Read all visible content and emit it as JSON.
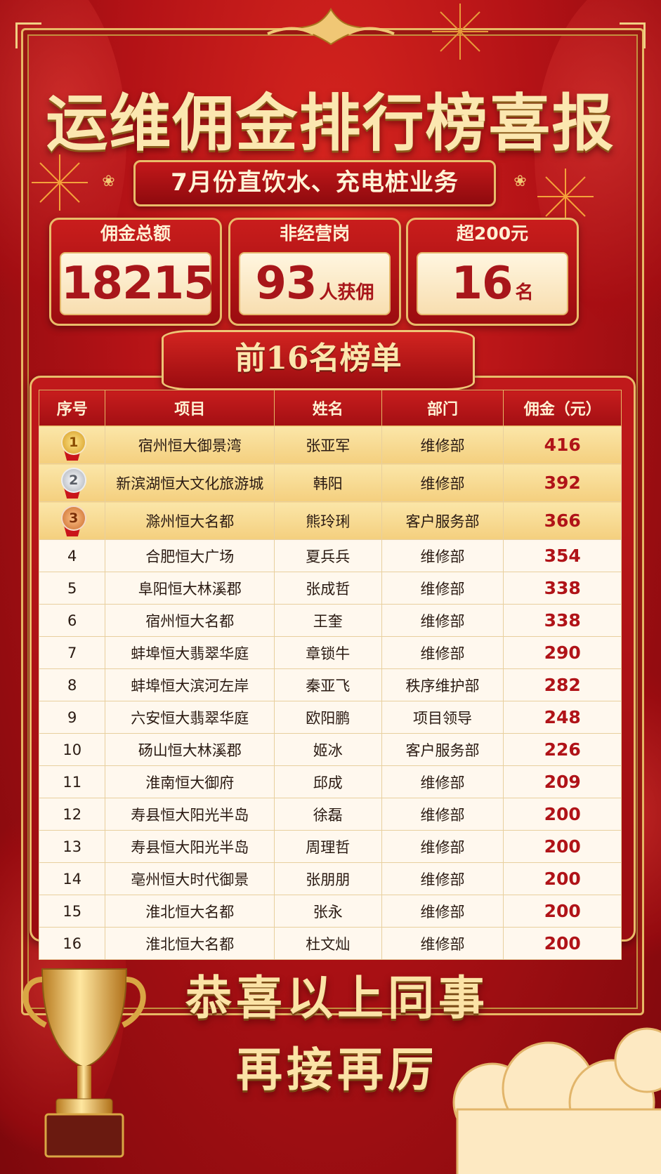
{
  "title": "运维佣金排行榜喜报",
  "subtitle": "7月份直饮水、充电桩业务",
  "stats": [
    {
      "label": "佣金总额",
      "value": "18215",
      "unit": ""
    },
    {
      "label": "非经营岗",
      "value": "93",
      "unit": "人获佣"
    },
    {
      "label": "超200元",
      "value": "16",
      "unit": "名"
    }
  ],
  "rank_title": "前16名榜单",
  "table": {
    "headers": [
      "序号",
      "项目",
      "姓名",
      "部门",
      "佣金（元）"
    ],
    "rows": [
      {
        "rank": "1",
        "project": "宿州恒大御景湾",
        "name": "张亚军",
        "dept": "维修部",
        "amount": "416"
      },
      {
        "rank": "2",
        "project": "新滨湖恒大文化旅游城",
        "name": "韩阳",
        "dept": "维修部",
        "amount": "392"
      },
      {
        "rank": "3",
        "project": "滁州恒大名都",
        "name": "熊玲琍",
        "dept": "客户服务部",
        "amount": "366"
      },
      {
        "rank": "4",
        "project": "合肥恒大广场",
        "name": "夏兵兵",
        "dept": "维修部",
        "amount": "354"
      },
      {
        "rank": "5",
        "project": "阜阳恒大林溪郡",
        "name": "张成哲",
        "dept": "维修部",
        "amount": "338"
      },
      {
        "rank": "6",
        "project": "宿州恒大名都",
        "name": "王奎",
        "dept": "维修部",
        "amount": "338"
      },
      {
        "rank": "7",
        "project": "蚌埠恒大翡翠华庭",
        "name": "章锁牛",
        "dept": "维修部",
        "amount": "290"
      },
      {
        "rank": "8",
        "project": "蚌埠恒大滨河左岸",
        "name": "秦亚飞",
        "dept": "秩序维护部",
        "amount": "282"
      },
      {
        "rank": "9",
        "project": "六安恒大翡翠华庭",
        "name": "欧阳鹏",
        "dept": "项目领导",
        "amount": "248"
      },
      {
        "rank": "10",
        "project": "砀山恒大林溪郡",
        "name": "姬冰",
        "dept": "客户服务部",
        "amount": "226"
      },
      {
        "rank": "11",
        "project": "淮南恒大御府",
        "name": "邱成",
        "dept": "维修部",
        "amount": "209"
      },
      {
        "rank": "12",
        "project": "寿县恒大阳光半岛",
        "name": "徐磊",
        "dept": "维修部",
        "amount": "200"
      },
      {
        "rank": "13",
        "project": "寿县恒大阳光半岛",
        "name": "周理哲",
        "dept": "维修部",
        "amount": "200"
      },
      {
        "rank": "14",
        "project": "亳州恒大时代御景",
        "name": "张朋朋",
        "dept": "维修部",
        "amount": "200"
      },
      {
        "rank": "15",
        "project": "淮北恒大名都",
        "name": "张永",
        "dept": "维修部",
        "amount": "200"
      },
      {
        "rank": "16",
        "project": "淮北恒大名都",
        "name": "杜文灿",
        "dept": "维修部",
        "amount": "200"
      }
    ]
  },
  "footer": {
    "line1": "恭喜以上同事",
    "line2": "再接再厉"
  },
  "colors": {
    "primary_red": "#b31216",
    "gold": "#e9bc6a",
    "amount_red": "#b01318",
    "cream": "#fff8ee"
  },
  "icons": [
    "gold-medal-icon",
    "silver-medal-icon",
    "bronze-medal-icon",
    "trophy-icon",
    "firework-icon",
    "cloud-icon"
  ]
}
